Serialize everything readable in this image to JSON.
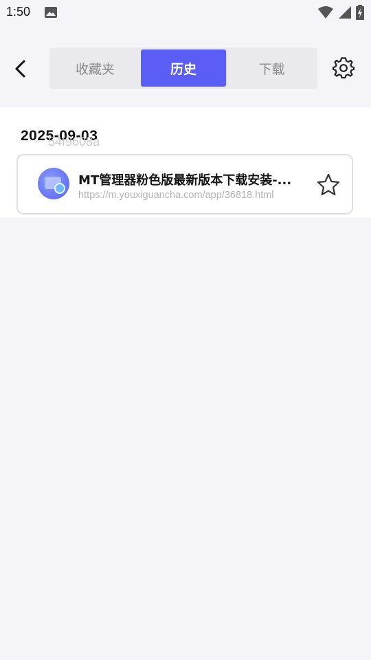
{
  "status_bar": {
    "time": "1:50",
    "icons": [
      "image-icon",
      "wifi-icon",
      "signal-icon",
      "battery-charging-icon"
    ]
  },
  "header": {
    "back_icon": "chevron-left-icon",
    "tabs": [
      {
        "label": "收藏夹",
        "active": false
      },
      {
        "label": "历史",
        "active": true
      },
      {
        "label": "下载",
        "active": false
      }
    ],
    "settings_icon": "gear-icon"
  },
  "history": {
    "date": "2025-09-03",
    "ghost_text": "54f9608a",
    "items": [
      {
        "title": "MT管理器粉色版最新版本下载安装-...",
        "url": "https://m.youxiguancha.com/app/36818.html",
        "favorite_icon": "star-outline-icon"
      }
    ]
  },
  "colors": {
    "accent": "#5b5ef5",
    "background": "#f5f5f9",
    "tab_track": "#e9e9ee"
  }
}
